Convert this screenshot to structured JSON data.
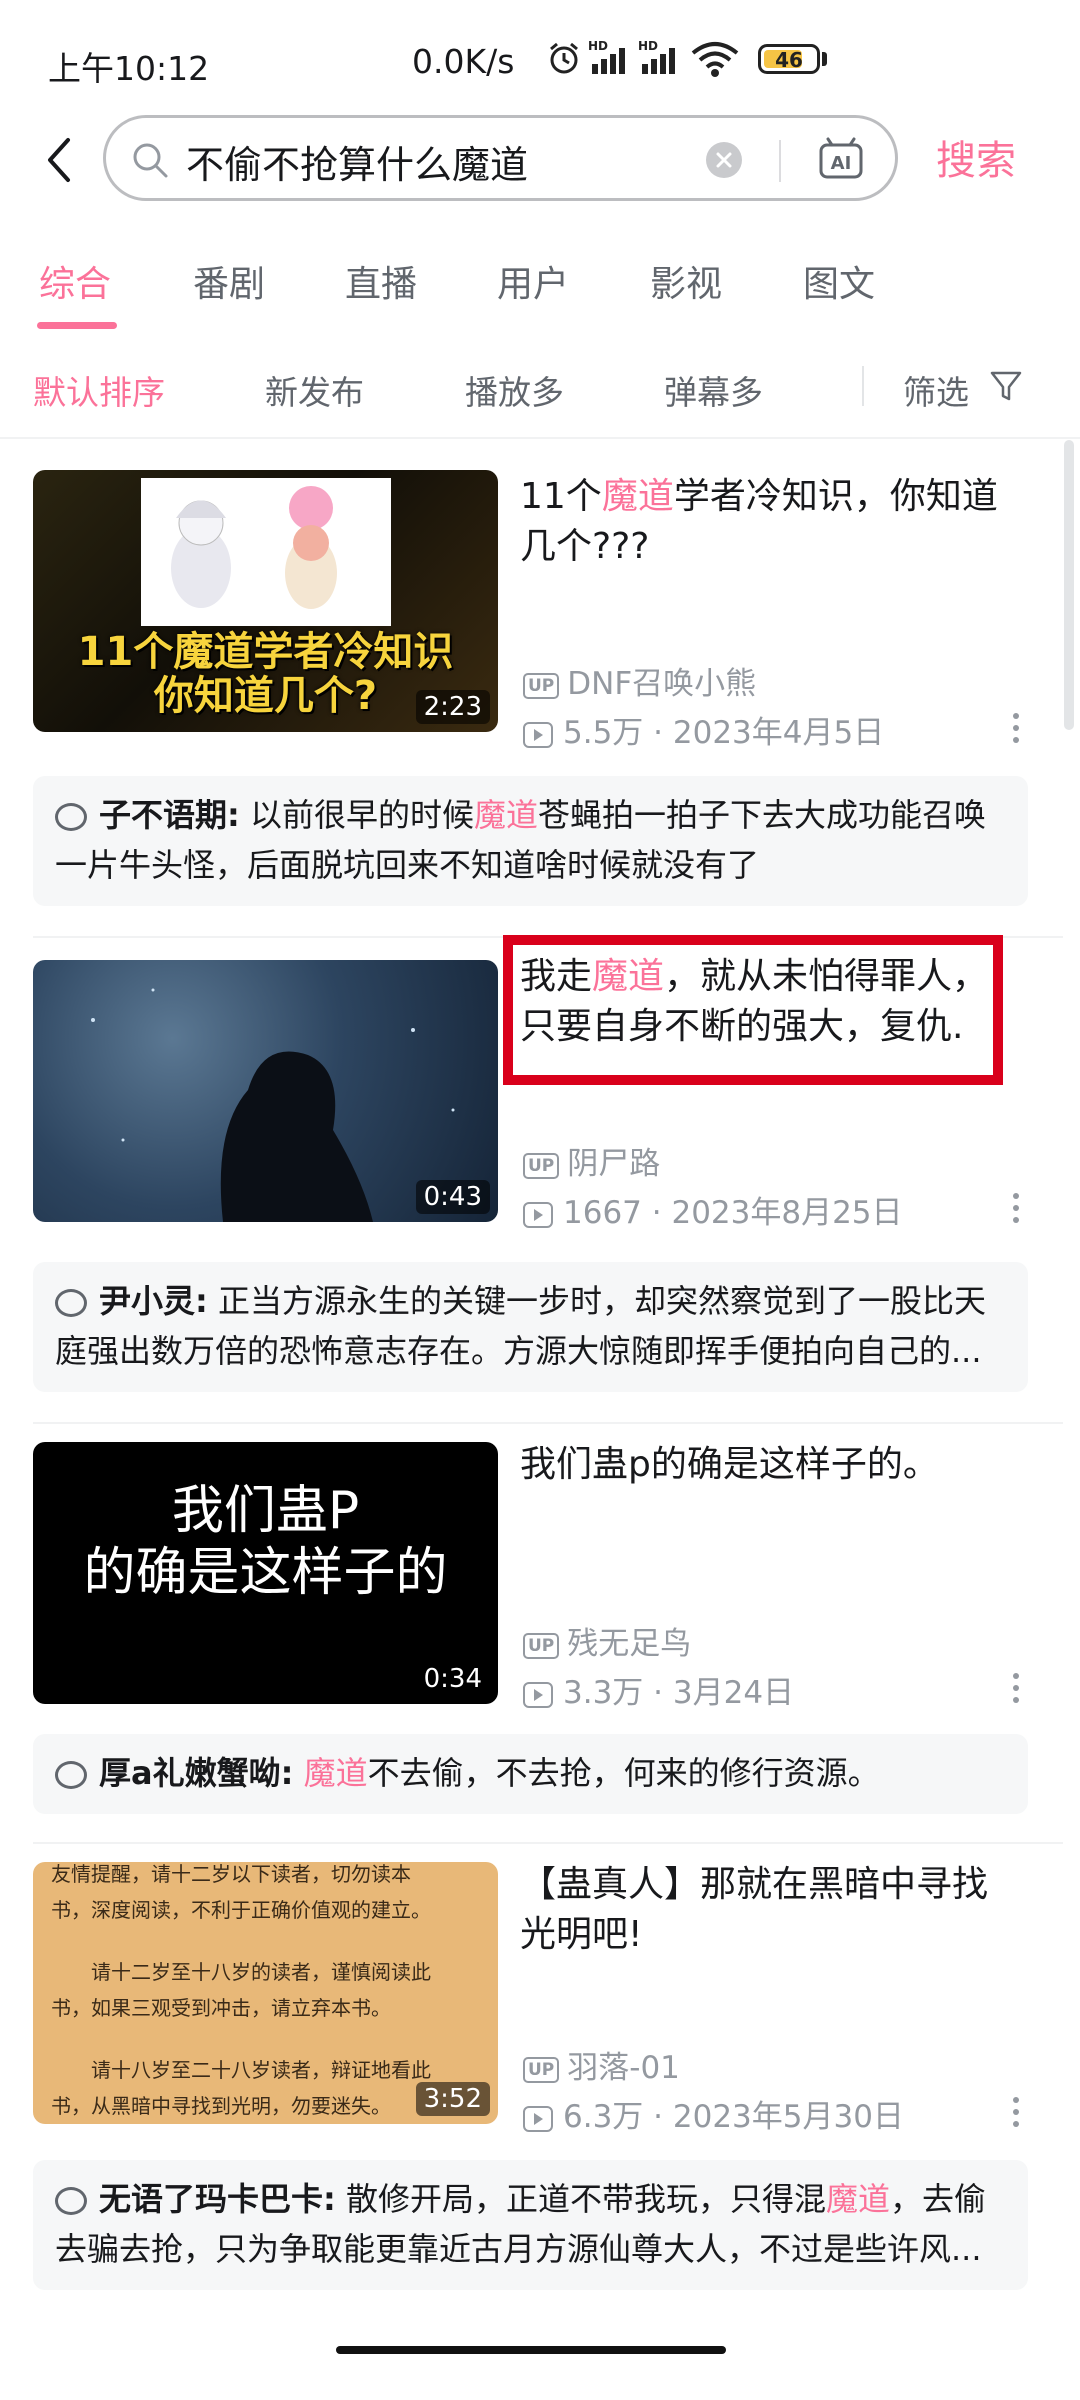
{
  "status_bar": {
    "time": "上午10:12",
    "net_speed": "0.0K/s",
    "battery": "46"
  },
  "search": {
    "query": "不偷不抢算什么魔道",
    "submit_label": "搜索",
    "ai_label": "AI"
  },
  "tabs": [
    {
      "label": "综合",
      "active": true
    },
    {
      "label": "番剧",
      "active": false
    },
    {
      "label": "直播",
      "active": false
    },
    {
      "label": "用户",
      "active": false
    },
    {
      "label": "影视",
      "active": false
    },
    {
      "label": "图文",
      "active": false
    }
  ],
  "sort": {
    "options": [
      "默认排序",
      "新发布",
      "播放多",
      "弹幕多"
    ],
    "active": "默认排序",
    "filter_label": "筛选"
  },
  "videos": [
    {
      "thumb_caption_1": "11个魔道学者冷知识",
      "thumb_caption_2": "你知道几个?",
      "duration": "2:23",
      "title_pre": "11个",
      "title_hl": "魔道",
      "title_post": "学者冷知识，你知道几个???",
      "uploader": "DNF召唤小熊",
      "views": "5.5万",
      "date": "2023年4月5日",
      "comment_author": "子不语期:",
      "comment_pre": "以前很早的时候",
      "comment_hl": "魔道",
      "comment_post": "苍蝇拍一拍子下去大成功能召唤一片牛头怪，后面脱坑回来不知道啥时候就没有了"
    },
    {
      "duration": "0:43",
      "title_pre": "我走",
      "title_hl": "魔道",
      "title_post": "，就从未怕得罪人，只要自身不断的强大，复仇.",
      "uploader": "阴尸路",
      "views": "1667",
      "date": "2023年8月25日",
      "comment_author": "尹小灵:",
      "comment_pre": "正当方源永生的关键一步时，却突然察觉到了一股比天庭强出数万倍的恐怖意志存在。方源大惊随即挥手便拍向自己的...",
      "comment_hl": "",
      "comment_post": ""
    },
    {
      "thumb_caption_1": "我们蛊P",
      "thumb_caption_2": "的确是这样子的",
      "duration": "0:34",
      "title_pre": "我们蛊p的确是这样子的。",
      "title_hl": "",
      "title_post": "",
      "uploader": "残无足鸟",
      "views": "3.3万",
      "date": "3月24日",
      "comment_author": "厚a礼嫩蟹呦:",
      "comment_pre": "",
      "comment_hl": "魔道",
      "comment_post": "不去偷，不去抢，何来的修行资源。"
    },
    {
      "thumb_lines": [
        "友情提醒，请十二岁以下读者，切勿读本",
        "书，深度阅读，不利于正确价值观的建立。",
        "请十二岁至十八岁的读者，谨慎阅读此",
        "书，如果三观受到冲击，请立弃本书。",
        "请十八岁至二十八岁读者，辩证地看此",
        "书，从黑暗中寻找到光明，勿要迷失。"
      ],
      "duration": "3:52",
      "title_pre": "【蛊真人】那就在黑暗中寻找光明吧!",
      "title_hl": "",
      "title_post": "",
      "uploader": "羽落-01",
      "views": "6.3万",
      "date": "2023年5月30日",
      "comment_author": "无语了玛卡巴卡:",
      "comment_pre": "散修开局，正道不带我玩，只得混",
      "comment_hl": "魔道",
      "comment_post": "，去偷去骗去抢，只为争取能更靠近古月方源仙尊大人，不过是些许风..."
    }
  ]
}
